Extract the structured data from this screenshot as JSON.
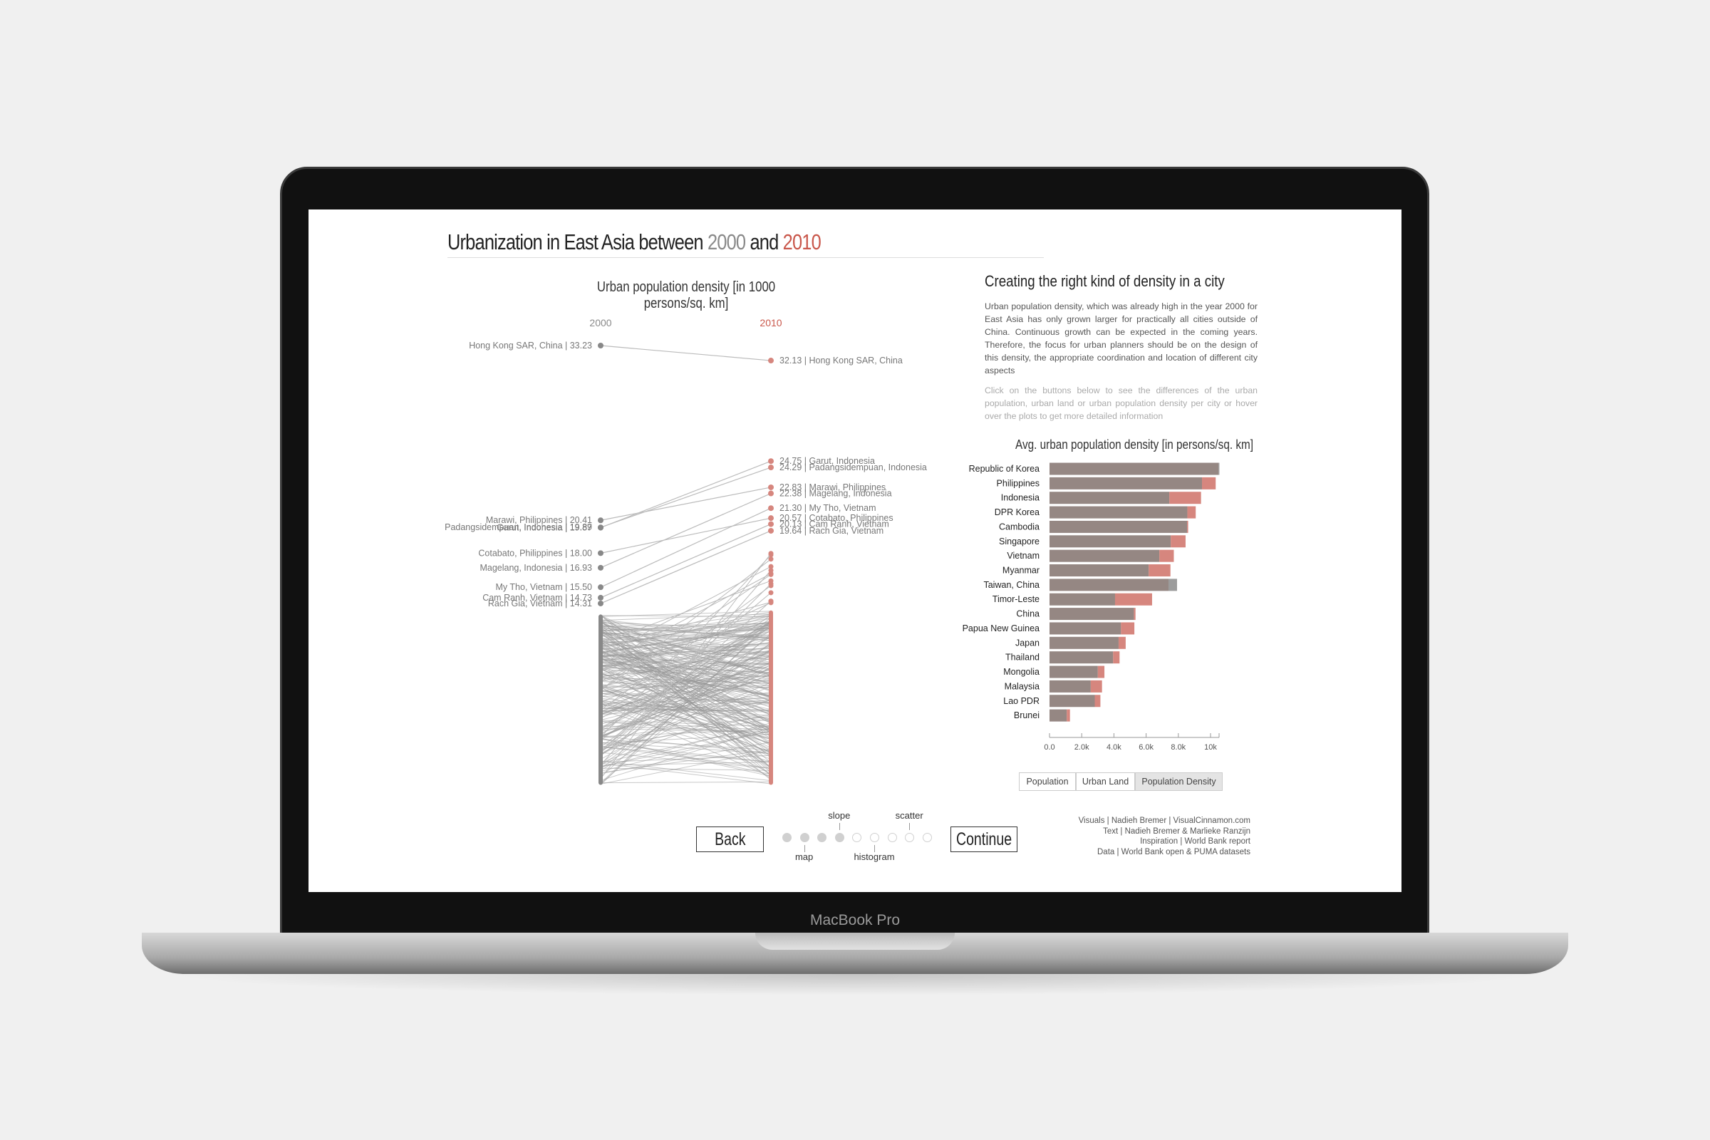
{
  "device": {
    "label": "MacBook Pro"
  },
  "header": {
    "title_prefix": "Urbanization in East Asia between ",
    "year_start": "2000",
    "title_mid": " and ",
    "year_end": "2010"
  },
  "colors": {
    "year_2000": "#8a8a8a",
    "year_2010": "#c9574b",
    "bar_base": "#958783",
    "bar_increase": "#d6867e",
    "bar_decrease": "#9c9c9c",
    "background": "#f0f0f0"
  },
  "side": {
    "title": "Creating the right kind of density in a city",
    "paragraph1": "Urban population density, which was already high in the year 2000 for East Asia has only grown larger for practically all cities outside of China. Continuous growth can be expected in the coming years. Therefore, the focus for urban planners should be on the design of this density, the appropriate coordination and location of different city aspects",
    "paragraph2": "Click on the buttons below to see the differences of the urban population, urban land or urban population density per city or hover over the plots to get more detailed information"
  },
  "toggles": [
    {
      "label": "Population",
      "active": false
    },
    {
      "label": "Urban Land",
      "active": false
    },
    {
      "label": "Population Density",
      "active": true
    }
  ],
  "nav": {
    "back": "Back",
    "continue": "Continue",
    "steps_total": 9,
    "current_step": 4,
    "step_labels": [
      {
        "step": 2,
        "label": "map",
        "pos": "below"
      },
      {
        "step": 4,
        "label": "slope",
        "pos": "above"
      },
      {
        "step": 6,
        "label": "histogram",
        "pos": "below"
      },
      {
        "step": 8,
        "label": "scatter",
        "pos": "above"
      }
    ]
  },
  "credits": [
    "Visuals | Nadieh Bremer | VisualCinnamon.com",
    "Text | Nadieh Bremer & Marlieke Ranzijn",
    "Inspiration | World Bank report",
    "Data | World Bank open & PUMA datasets"
  ],
  "chart_data": [
    {
      "type": "slope",
      "title": "Urban population density [in 1000 persons/sq. km]",
      "x_labels": [
        "2000",
        "2010"
      ],
      "labeled_cities_2000": [
        {
          "city": "Hong Kong SAR, China",
          "value": 33.23
        },
        {
          "city": "Marawi, Philippines",
          "value": 20.41
        },
        {
          "city": "Padangsidempuan, Indonesia",
          "value": 19.89
        },
        {
          "city": "Garut, Indonesia",
          "value": 19.87
        },
        {
          "city": "Cotabato, Philippines",
          "value": 18.0
        },
        {
          "city": "Magelang, Indonesia",
          "value": 16.93
        },
        {
          "city": "My Tho, Vietnam",
          "value": 15.5
        },
        {
          "city": "Cam Ranh, Vietnam",
          "value": 14.73
        },
        {
          "city": "Rach Gia, Vietnam",
          "value": 14.31
        }
      ],
      "labeled_cities_2010": [
        {
          "city": "Hong Kong SAR, China",
          "value": 32.13
        },
        {
          "city": "Garut, Indonesia",
          "value": 24.75
        },
        {
          "city": "Padangsidempuan, Indonesia",
          "value": 24.29
        },
        {
          "city": "Marawi, Philippines",
          "value": 22.83
        },
        {
          "city": "Magelang, Indonesia",
          "value": 22.38
        },
        {
          "city": "My Tho, Vietnam",
          "value": 21.3
        },
        {
          "city": "Cotabato, Philippines",
          "value": 20.57
        },
        {
          "city": "Cam Ranh, Vietnam",
          "value": 20.13
        },
        {
          "city": "Rach Gia, Vietnam",
          "value": 19.64
        }
      ]
    },
    {
      "type": "bar",
      "orientation": "horizontal",
      "title": "Avg. urban population density [in persons/sq. km]",
      "xlim": [
        0,
        10000
      ],
      "ticks": [
        "0.0",
        "2.0k",
        "4.0k",
        "6.0k",
        "8.0k",
        "10k"
      ],
      "tick_values": [
        0,
        2000,
        4000,
        6000,
        8000,
        10000
      ],
      "categories": [
        "Republic of Korea",
        "Philippines",
        "Indonesia",
        "DPR Korea",
        "Cambodia",
        "Singapore",
        "Vietnam",
        "Myanmar",
        "Taiwan, China",
        "Timor-Leste",
        "China",
        "Papua New Guinea",
        "Japan",
        "Thailand",
        "Mongolia",
        "Malaysia",
        "Lao PDR",
        "Brunei"
      ],
      "series": [
        {
          "name": "2000",
          "values": [
            10550,
            9470,
            7440,
            8560,
            8540,
            7530,
            6820,
            6160,
            7920,
            4070,
            5240,
            4440,
            4290,
            3950,
            3000,
            2560,
            2810,
            1070
          ]
        },
        {
          "name": "2010",
          "values": [
            10500,
            10320,
            9410,
            9080,
            8610,
            8450,
            7720,
            7510,
            7390,
            6370,
            5340,
            5270,
            4730,
            4350,
            3410,
            3260,
            3160,
            1270
          ]
        }
      ]
    }
  ]
}
